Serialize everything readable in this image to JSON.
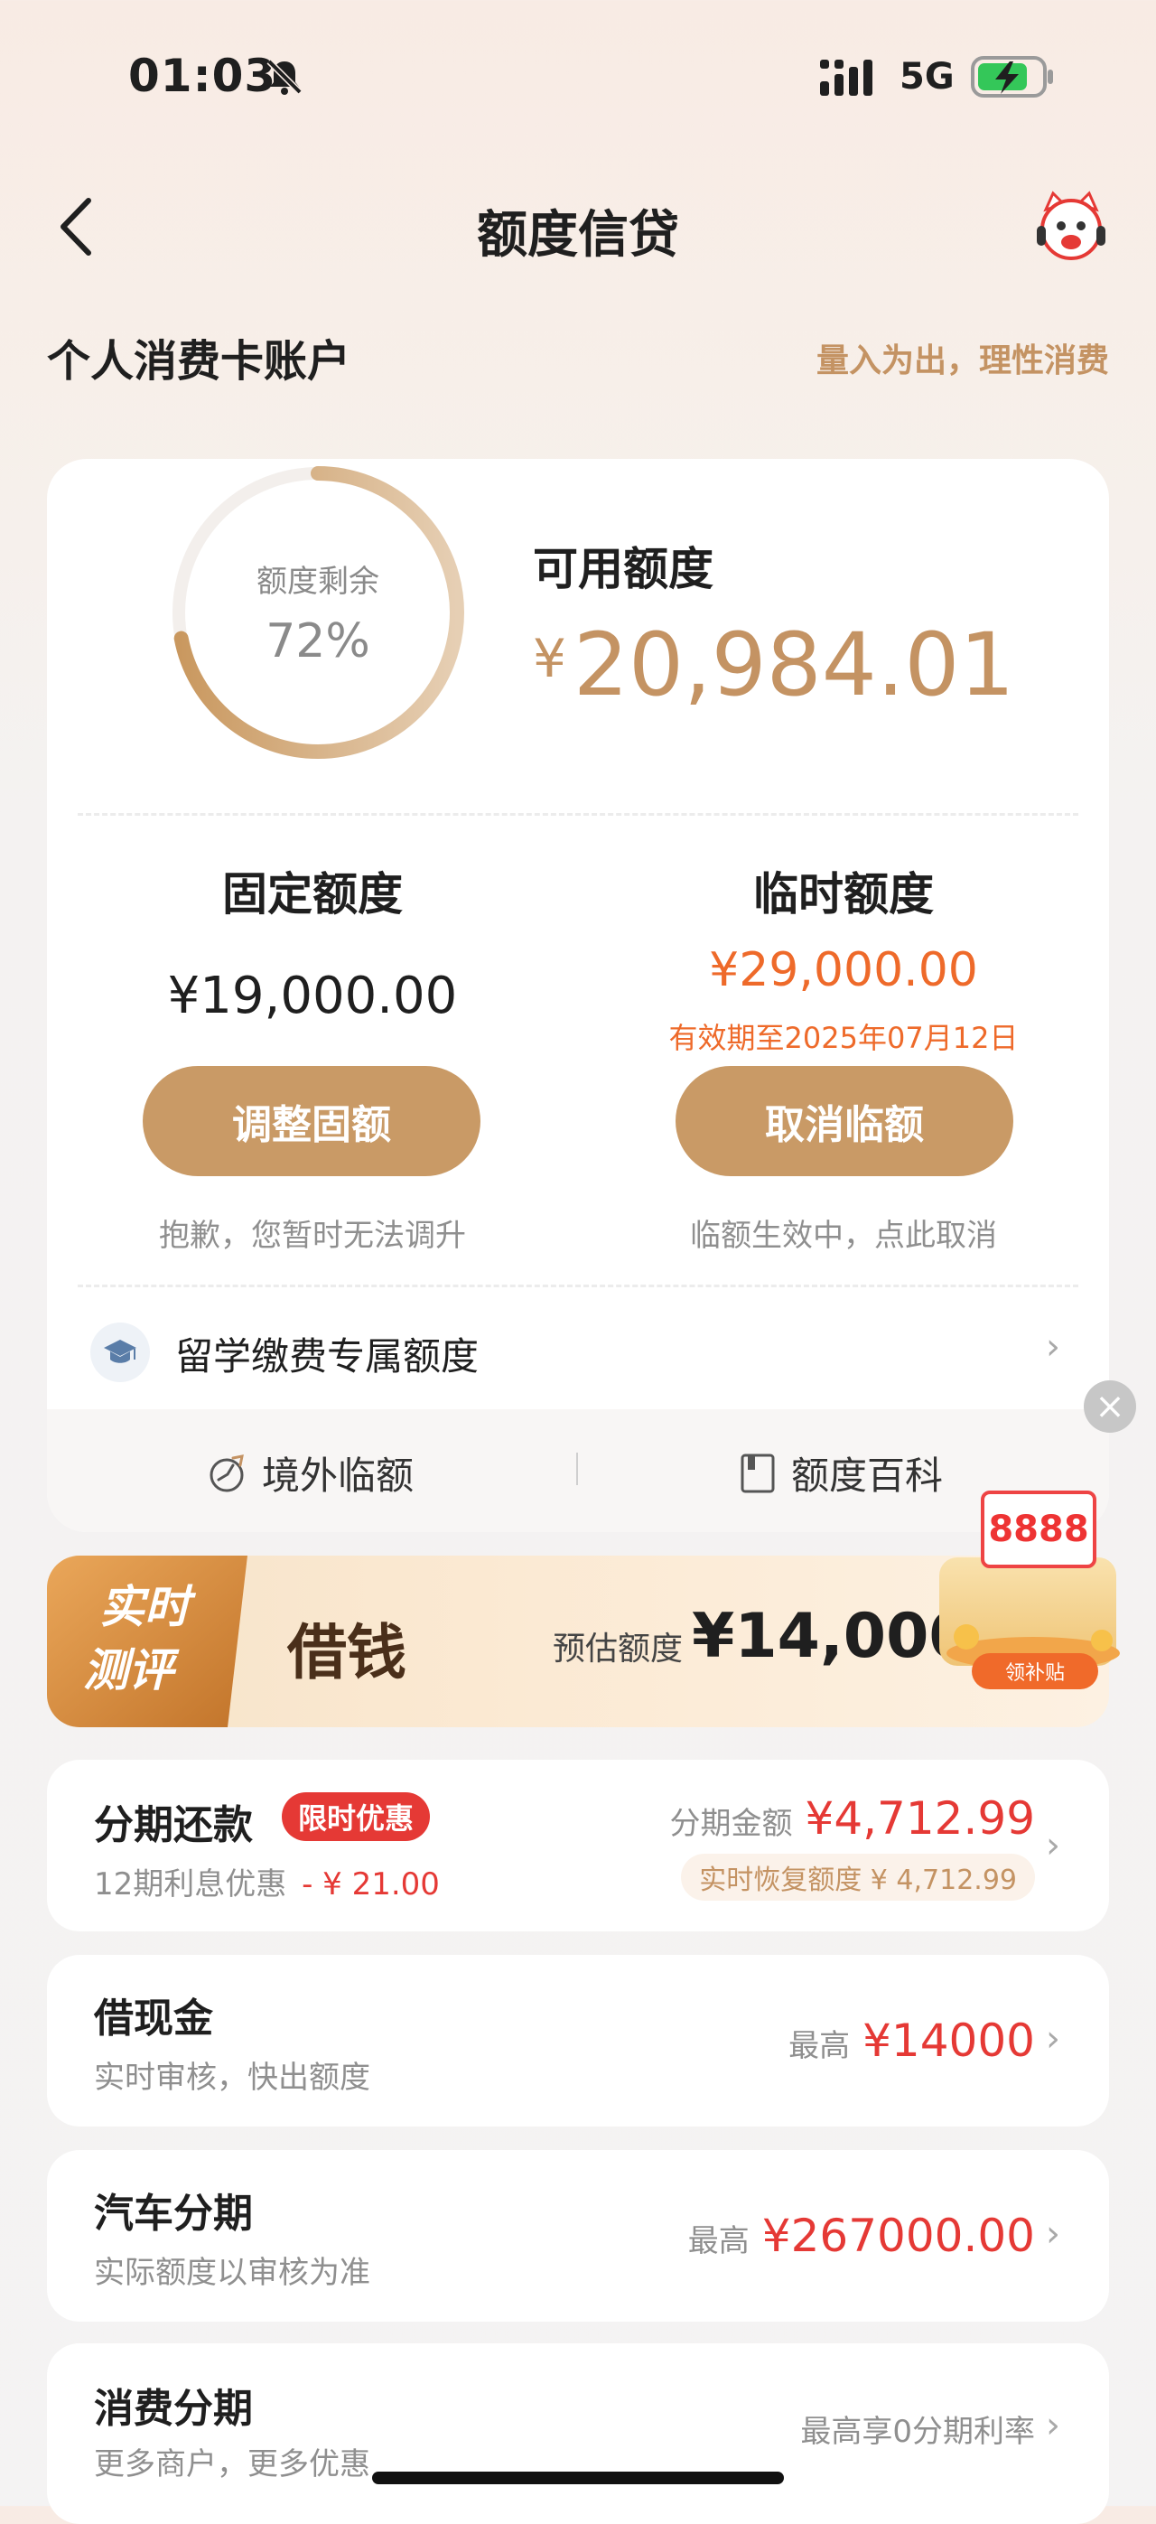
{
  "status_bar": {
    "time": "01:03",
    "network": "5G"
  },
  "nav": {
    "title": "额度信贷"
  },
  "section": {
    "title": "个人消费卡账户",
    "slogan": "量入为出，理性消费"
  },
  "summary": {
    "ring_label": "额度剩余",
    "ring_percent": "72%",
    "ring_fraction": 0.72,
    "available_label": "可用额度",
    "available_currency": "¥",
    "available_amount": "20,984.01"
  },
  "fixed": {
    "title": "固定额度",
    "amount": "¥19,000.00",
    "button": "调整固额",
    "hint": "抱歉，您暂时无法调升"
  },
  "temporary": {
    "title": "临时额度",
    "amount": "¥29,000.00",
    "validity": "有效期至2025年07月12日",
    "button": "取消临额",
    "hint": "临额生效中，点此取消"
  },
  "study": {
    "label": "留学缴费专属额度"
  },
  "footer_links": {
    "overseas": "境外临额",
    "wiki": "额度百科"
  },
  "banner": {
    "tag_line1": "实时",
    "tag_line2": "测评",
    "title": "借钱",
    "estimate_label": "预估额度",
    "estimate_amount": "¥14,000.0",
    "promo_number": "8888",
    "promo_button": "领补贴"
  },
  "rows": {
    "installment": {
      "title": "分期还款",
      "badge": "限时优惠",
      "sub": "12期利息优惠",
      "discount": "- ¥ 21.00",
      "right_label": "分期金额",
      "right_value": "¥4,712.99",
      "recover": "实时恢复额度 ¥ 4,712.99"
    },
    "cash": {
      "title": "借现金",
      "sub": "实时审核，快出额度",
      "right_label": "最高",
      "right_value": "¥14000"
    },
    "car": {
      "title": "汽车分期",
      "sub": "实际额度以审核为准",
      "right_label": "最高",
      "right_value": "¥267000.00"
    },
    "consumer": {
      "title": "消费分期",
      "sub": "更多商户，更多优惠",
      "right_label": "最高享0分期利率"
    }
  },
  "colors": {
    "accent_gold": "#c99a66",
    "orange": "#ee6a2a",
    "red": "#e53935"
  }
}
